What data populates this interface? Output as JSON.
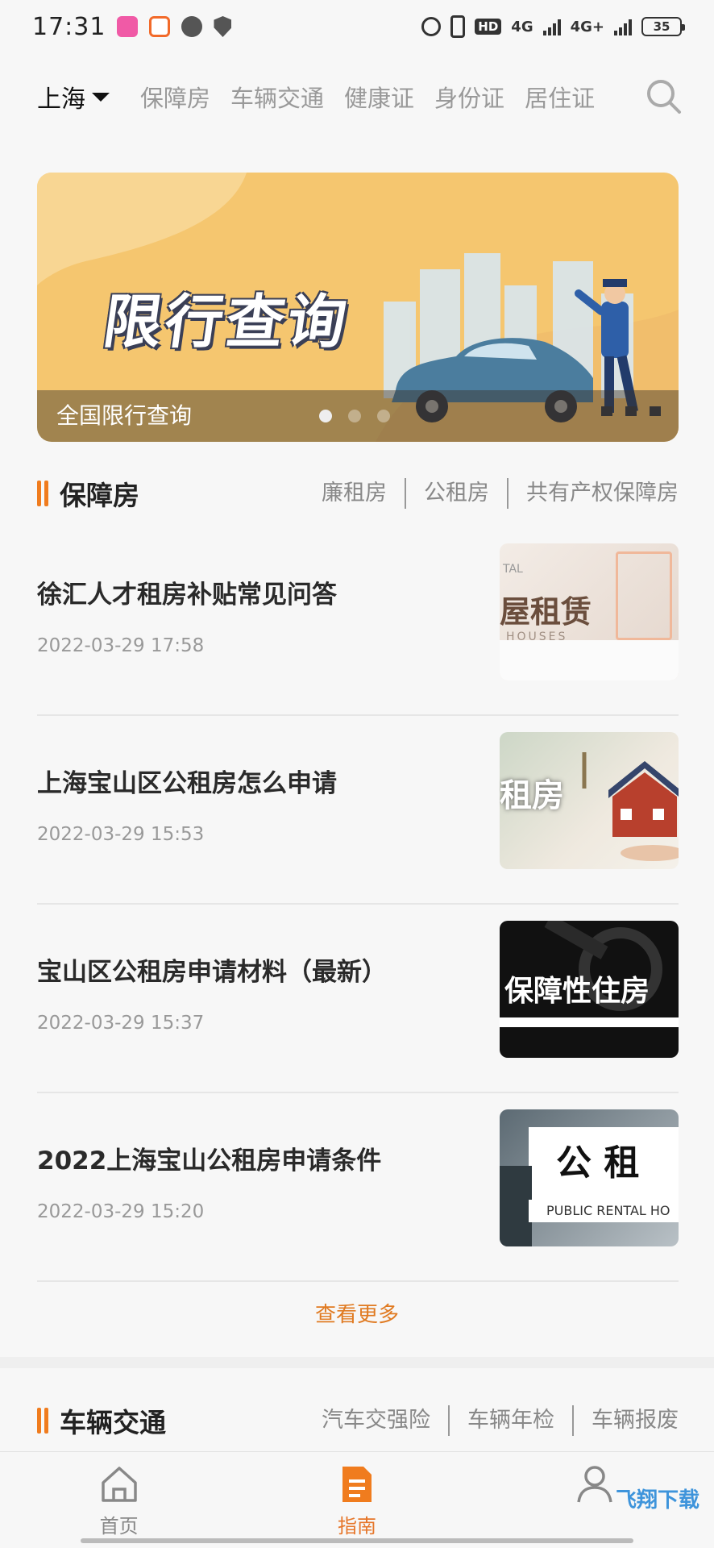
{
  "status_bar": {
    "time": "17:31",
    "network_1": "4G",
    "network_2": "4G+",
    "hd": "HD",
    "battery": "35"
  },
  "top_nav": {
    "city": "上海",
    "tabs": [
      "保障房",
      "车辆交通",
      "健康证",
      "身份证",
      "居住证"
    ]
  },
  "banner": {
    "title": "限行查询",
    "caption": "全国限行查询"
  },
  "section_housing": {
    "title": "保障房",
    "links": [
      "廉租房",
      "公租房",
      "共有产权保障房"
    ],
    "articles": [
      {
        "title": "徐汇人才租房补贴常见问答",
        "date": "2022-03-29 17:58",
        "thumb_text": "屋租赁",
        "thumb_sub": "HOUSES",
        "thumb_top": "TAL"
      },
      {
        "title": "上海宝山区公租房怎么申请",
        "date": "2022-03-29 15:53",
        "thumb_text": "租房"
      },
      {
        "title": "宝山区公租房申请材料（最新）",
        "date": "2022-03-29 15:37",
        "thumb_text": "保障性住房"
      },
      {
        "title": "2022上海宝山公租房申请条件",
        "date": "2022-03-29 15:20",
        "thumb_text": "公 租 ",
        "thumb_sub": "PUBLIC RENTAL HO"
      }
    ],
    "see_more": "查看更多"
  },
  "section_traffic": {
    "title": "车辆交通",
    "links": [
      "汽车交强险",
      "车辆年检",
      "车辆报废"
    ]
  },
  "bottom_nav": {
    "items": [
      "首页",
      "指南",
      ""
    ]
  },
  "watermark": "飞翔下载",
  "colors": {
    "accent": "#f07c1e",
    "banner_bg": "#f5c66f"
  }
}
